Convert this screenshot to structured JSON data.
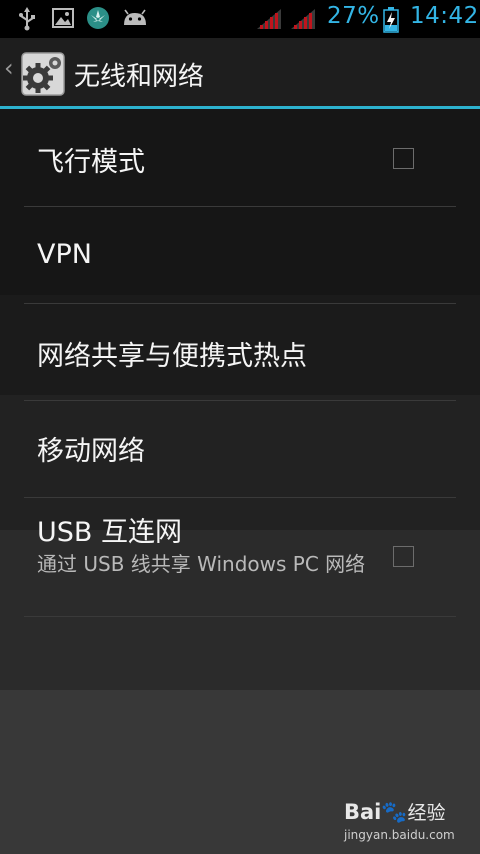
{
  "status_bar": {
    "battery_percent": "27%",
    "time": "14:42",
    "accent_color": "#33b5e5",
    "icons": [
      "usb-icon",
      "image-icon",
      "huawei-icon",
      "android-icon",
      "signal-icon",
      "signal-icon",
      "battery-charging-icon"
    ]
  },
  "action_bar": {
    "title": "无线和网络",
    "icon": "settings-gear-icon",
    "divider_color": "#2db2cf"
  },
  "settings": [
    {
      "title": "飞行模式",
      "has_checkbox": true,
      "checked": false
    },
    {
      "title": "VPN"
    },
    {
      "title": "网络共享与便携式热点"
    },
    {
      "title": "移动网络"
    },
    {
      "title": "USB 互连网",
      "summary": "通过 USB 线共享 Windows PC 网络",
      "has_checkbox": true,
      "checked": false
    }
  ],
  "watermark": {
    "logo": "Bai",
    "logo_suffix": "经验",
    "url": "jingyan.baidu.com"
  }
}
